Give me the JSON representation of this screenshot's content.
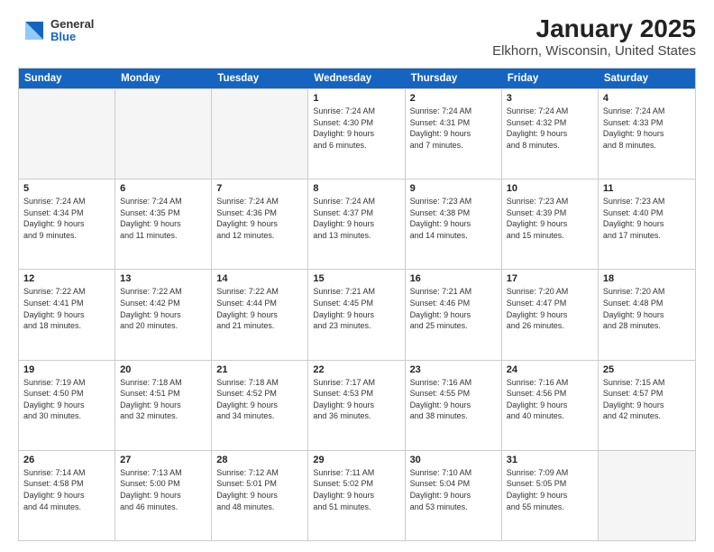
{
  "logo": {
    "general": "General",
    "blue": "Blue"
  },
  "title": "January 2025",
  "subtitle": "Elkhorn, Wisconsin, United States",
  "days_of_week": [
    "Sunday",
    "Monday",
    "Tuesday",
    "Wednesday",
    "Thursday",
    "Friday",
    "Saturday"
  ],
  "rows": [
    [
      {
        "day": "",
        "info": "",
        "empty": true
      },
      {
        "day": "",
        "info": "",
        "empty": true
      },
      {
        "day": "",
        "info": "",
        "empty": true
      },
      {
        "day": "1",
        "info": "Sunrise: 7:24 AM\nSunset: 4:30 PM\nDaylight: 9 hours\nand 6 minutes."
      },
      {
        "day": "2",
        "info": "Sunrise: 7:24 AM\nSunset: 4:31 PM\nDaylight: 9 hours\nand 7 minutes."
      },
      {
        "day": "3",
        "info": "Sunrise: 7:24 AM\nSunset: 4:32 PM\nDaylight: 9 hours\nand 8 minutes."
      },
      {
        "day": "4",
        "info": "Sunrise: 7:24 AM\nSunset: 4:33 PM\nDaylight: 9 hours\nand 8 minutes."
      }
    ],
    [
      {
        "day": "5",
        "info": "Sunrise: 7:24 AM\nSunset: 4:34 PM\nDaylight: 9 hours\nand 9 minutes."
      },
      {
        "day": "6",
        "info": "Sunrise: 7:24 AM\nSunset: 4:35 PM\nDaylight: 9 hours\nand 11 minutes."
      },
      {
        "day": "7",
        "info": "Sunrise: 7:24 AM\nSunset: 4:36 PM\nDaylight: 9 hours\nand 12 minutes."
      },
      {
        "day": "8",
        "info": "Sunrise: 7:24 AM\nSunset: 4:37 PM\nDaylight: 9 hours\nand 13 minutes."
      },
      {
        "day": "9",
        "info": "Sunrise: 7:23 AM\nSunset: 4:38 PM\nDaylight: 9 hours\nand 14 minutes."
      },
      {
        "day": "10",
        "info": "Sunrise: 7:23 AM\nSunset: 4:39 PM\nDaylight: 9 hours\nand 15 minutes."
      },
      {
        "day": "11",
        "info": "Sunrise: 7:23 AM\nSunset: 4:40 PM\nDaylight: 9 hours\nand 17 minutes."
      }
    ],
    [
      {
        "day": "12",
        "info": "Sunrise: 7:22 AM\nSunset: 4:41 PM\nDaylight: 9 hours\nand 18 minutes."
      },
      {
        "day": "13",
        "info": "Sunrise: 7:22 AM\nSunset: 4:42 PM\nDaylight: 9 hours\nand 20 minutes."
      },
      {
        "day": "14",
        "info": "Sunrise: 7:22 AM\nSunset: 4:44 PM\nDaylight: 9 hours\nand 21 minutes."
      },
      {
        "day": "15",
        "info": "Sunrise: 7:21 AM\nSunset: 4:45 PM\nDaylight: 9 hours\nand 23 minutes."
      },
      {
        "day": "16",
        "info": "Sunrise: 7:21 AM\nSunset: 4:46 PM\nDaylight: 9 hours\nand 25 minutes."
      },
      {
        "day": "17",
        "info": "Sunrise: 7:20 AM\nSunset: 4:47 PM\nDaylight: 9 hours\nand 26 minutes."
      },
      {
        "day": "18",
        "info": "Sunrise: 7:20 AM\nSunset: 4:48 PM\nDaylight: 9 hours\nand 28 minutes."
      }
    ],
    [
      {
        "day": "19",
        "info": "Sunrise: 7:19 AM\nSunset: 4:50 PM\nDaylight: 9 hours\nand 30 minutes."
      },
      {
        "day": "20",
        "info": "Sunrise: 7:18 AM\nSunset: 4:51 PM\nDaylight: 9 hours\nand 32 minutes."
      },
      {
        "day": "21",
        "info": "Sunrise: 7:18 AM\nSunset: 4:52 PM\nDaylight: 9 hours\nand 34 minutes."
      },
      {
        "day": "22",
        "info": "Sunrise: 7:17 AM\nSunset: 4:53 PM\nDaylight: 9 hours\nand 36 minutes."
      },
      {
        "day": "23",
        "info": "Sunrise: 7:16 AM\nSunset: 4:55 PM\nDaylight: 9 hours\nand 38 minutes."
      },
      {
        "day": "24",
        "info": "Sunrise: 7:16 AM\nSunset: 4:56 PM\nDaylight: 9 hours\nand 40 minutes."
      },
      {
        "day": "25",
        "info": "Sunrise: 7:15 AM\nSunset: 4:57 PM\nDaylight: 9 hours\nand 42 minutes."
      }
    ],
    [
      {
        "day": "26",
        "info": "Sunrise: 7:14 AM\nSunset: 4:58 PM\nDaylight: 9 hours\nand 44 minutes."
      },
      {
        "day": "27",
        "info": "Sunrise: 7:13 AM\nSunset: 5:00 PM\nDaylight: 9 hours\nand 46 minutes."
      },
      {
        "day": "28",
        "info": "Sunrise: 7:12 AM\nSunset: 5:01 PM\nDaylight: 9 hours\nand 48 minutes."
      },
      {
        "day": "29",
        "info": "Sunrise: 7:11 AM\nSunset: 5:02 PM\nDaylight: 9 hours\nand 51 minutes."
      },
      {
        "day": "30",
        "info": "Sunrise: 7:10 AM\nSunset: 5:04 PM\nDaylight: 9 hours\nand 53 minutes."
      },
      {
        "day": "31",
        "info": "Sunrise: 7:09 AM\nSunset: 5:05 PM\nDaylight: 9 hours\nand 55 minutes."
      },
      {
        "day": "",
        "info": "",
        "empty": true
      }
    ]
  ]
}
